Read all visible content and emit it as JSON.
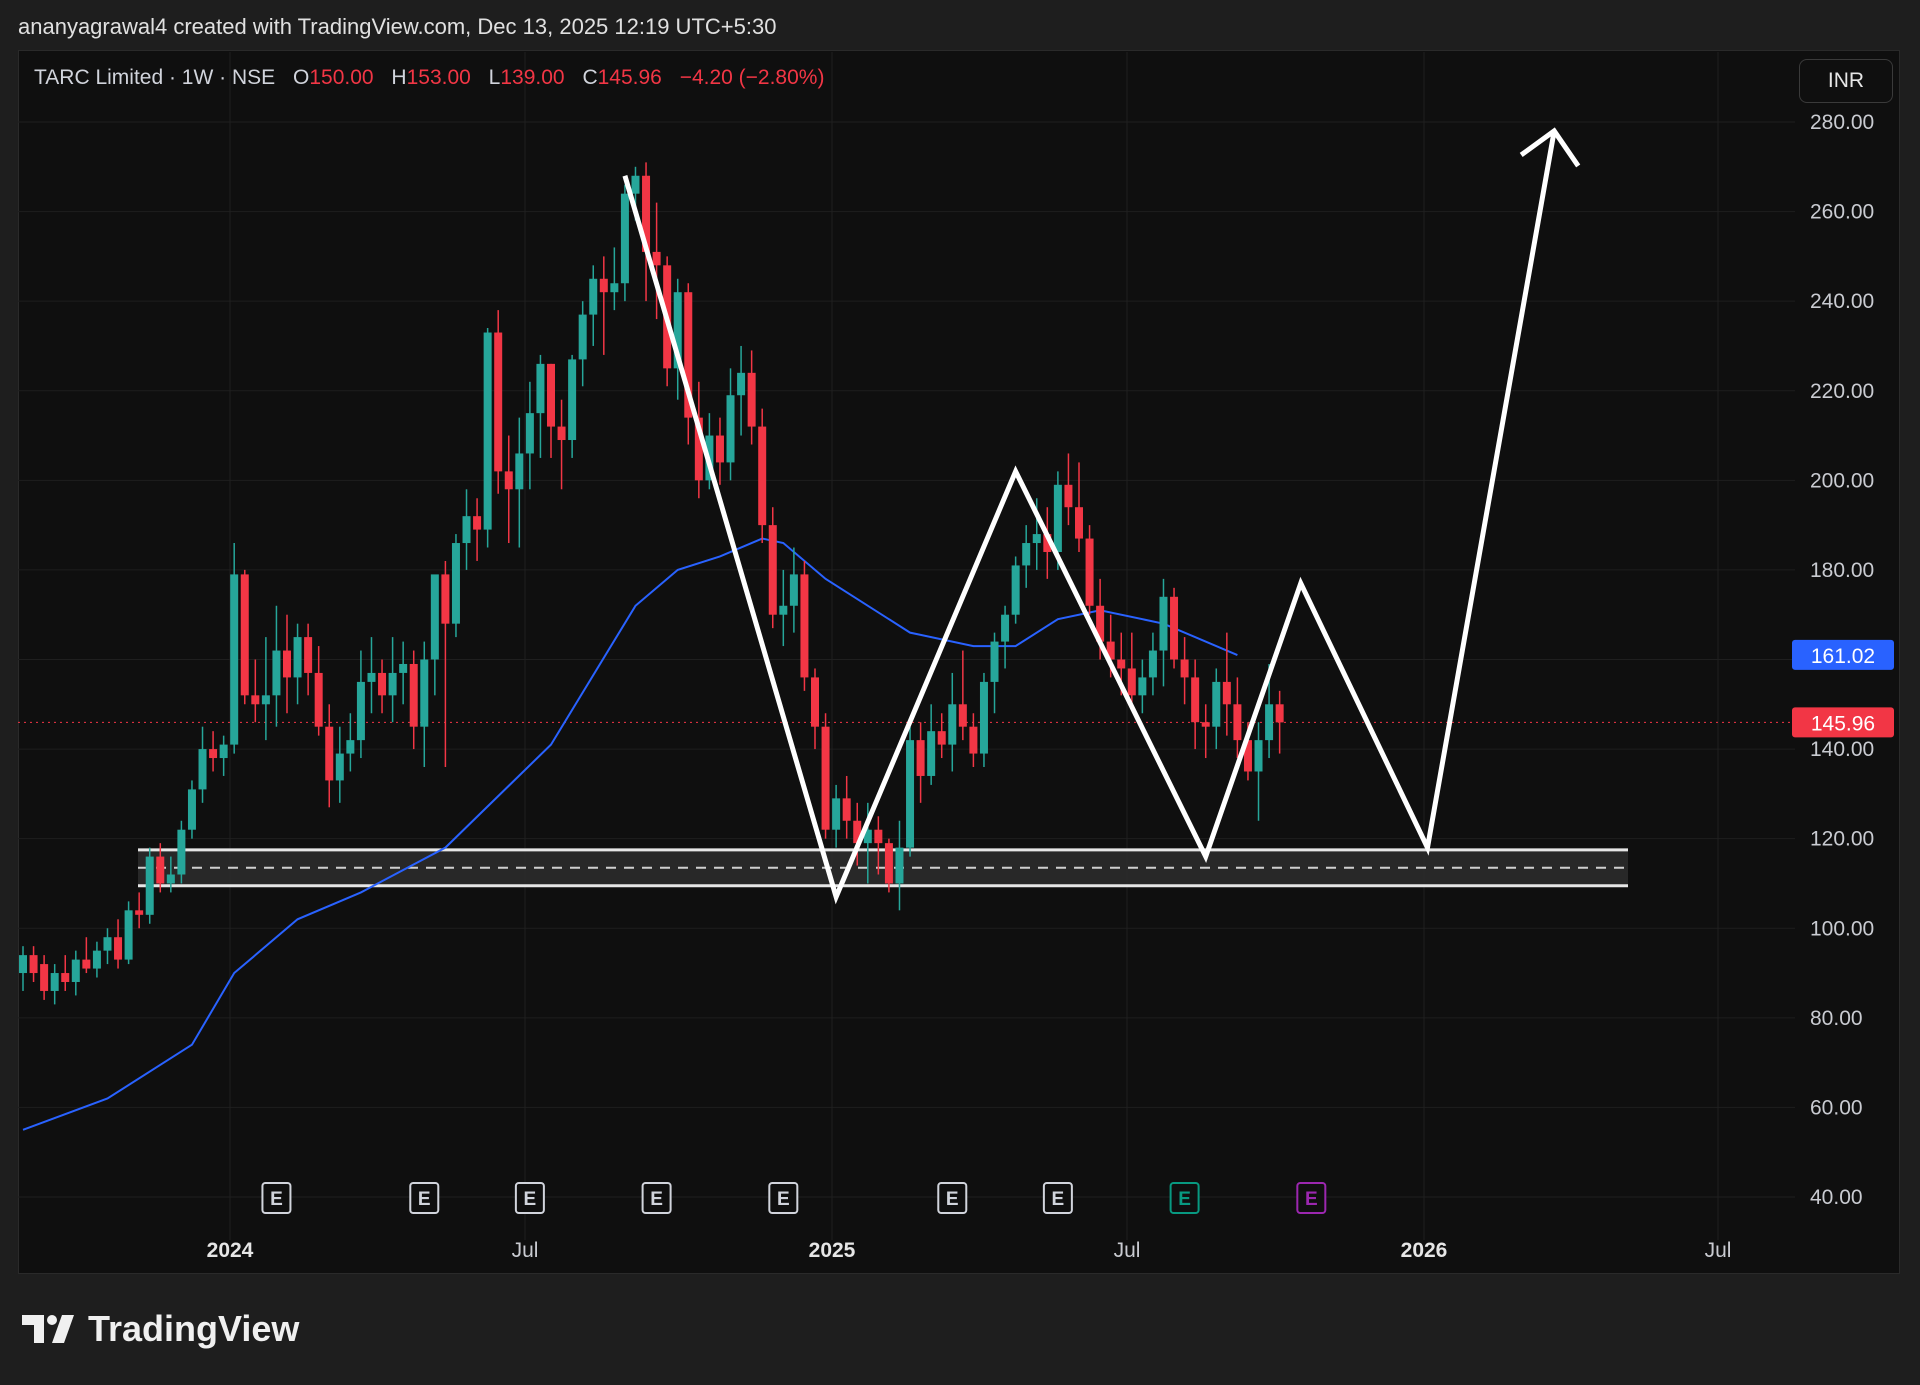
{
  "caption": "ananyagrawal4 created with TradingView.com, Dec 13, 2025 12:19 UTC+5:30",
  "legend": {
    "symbol": "TARC Limited · 1W · NSE",
    "o_label": "O",
    "o": "150.00",
    "h_label": "H",
    "h": "153.00",
    "l_label": "L",
    "l": "139.00",
    "c_label": "C",
    "c": "145.96",
    "change": "−4.20 (−2.80%)"
  },
  "currency_button": "INR",
  "brand": "TradingView",
  "colors": {
    "up": "#26a69a",
    "down": "#f23645",
    "ma": "#2962ff",
    "pattern": "#ffffff",
    "badge_ma": "#2962ff",
    "badge_price": "#f23645",
    "earnings_future": "#9c27b0",
    "earnings_next": "#089981"
  },
  "chart_data": {
    "type": "candlestick",
    "timeframe": "1W",
    "y_ticks": [
      "280.00",
      "260.00",
      "240.00",
      "220.00",
      "200.00",
      "180.00",
      "160.00",
      "140.00",
      "120.00",
      "100.00",
      "80.00",
      "60.00",
      "40.00"
    ],
    "ylim": [
      40,
      280
    ],
    "x_ticks": [
      "2024",
      "Jul",
      "2025",
      "Jul",
      "2026",
      "Jul"
    ],
    "last_price": 145.96,
    "last_price_label": "145.96",
    "ma_value": 161.02,
    "ma_label": "161.02",
    "ohlc": [
      {
        "o": 90,
        "h": 96,
        "l": 86,
        "c": 94
      },
      {
        "o": 94,
        "h": 96,
        "l": 88,
        "c": 90
      },
      {
        "o": 92,
        "h": 94,
        "l": 84,
        "c": 86
      },
      {
        "o": 86,
        "h": 92,
        "l": 83,
        "c": 90
      },
      {
        "o": 90,
        "h": 94,
        "l": 86,
        "c": 88
      },
      {
        "o": 88,
        "h": 95,
        "l": 85,
        "c": 93
      },
      {
        "o": 93,
        "h": 98,
        "l": 90,
        "c": 91
      },
      {
        "o": 91,
        "h": 97,
        "l": 89,
        "c": 95
      },
      {
        "o": 95,
        "h": 100,
        "l": 92,
        "c": 98
      },
      {
        "o": 98,
        "h": 102,
        "l": 91,
        "c": 93
      },
      {
        "o": 93,
        "h": 106,
        "l": 92,
        "c": 104
      },
      {
        "o": 104,
        "h": 108,
        "l": 100,
        "c": 103
      },
      {
        "o": 103,
        "h": 118,
        "l": 101,
        "c": 116
      },
      {
        "o": 116,
        "h": 119,
        "l": 108,
        "c": 110
      },
      {
        "o": 110,
        "h": 116,
        "l": 108,
        "c": 112
      },
      {
        "o": 112,
        "h": 124,
        "l": 110,
        "c": 122
      },
      {
        "o": 122,
        "h": 133,
        "l": 120,
        "c": 131
      },
      {
        "o": 131,
        "h": 145,
        "l": 128,
        "c": 140
      },
      {
        "o": 140,
        "h": 144,
        "l": 135,
        "c": 138
      },
      {
        "o": 138,
        "h": 143,
        "l": 134,
        "c": 141
      },
      {
        "o": 141,
        "h": 186,
        "l": 139,
        "c": 179
      },
      {
        "o": 179,
        "h": 180,
        "l": 150,
        "c": 152
      },
      {
        "o": 152,
        "h": 160,
        "l": 146,
        "c": 150
      },
      {
        "o": 150,
        "h": 165,
        "l": 142,
        "c": 152
      },
      {
        "o": 152,
        "h": 172,
        "l": 145,
        "c": 162
      },
      {
        "o": 162,
        "h": 170,
        "l": 148,
        "c": 156
      },
      {
        "o": 156,
        "h": 168,
        "l": 150,
        "c": 165
      },
      {
        "o": 165,
        "h": 168,
        "l": 152,
        "c": 157
      },
      {
        "o": 157,
        "h": 163,
        "l": 143,
        "c": 145
      },
      {
        "o": 145,
        "h": 150,
        "l": 127,
        "c": 133
      },
      {
        "o": 133,
        "h": 145,
        "l": 128,
        "c": 139
      },
      {
        "o": 139,
        "h": 148,
        "l": 135,
        "c": 142
      },
      {
        "o": 142,
        "h": 162,
        "l": 138,
        "c": 155
      },
      {
        "o": 155,
        "h": 165,
        "l": 148,
        "c": 157
      },
      {
        "o": 157,
        "h": 160,
        "l": 148,
        "c": 152
      },
      {
        "o": 152,
        "h": 165,
        "l": 146,
        "c": 157
      },
      {
        "o": 157,
        "h": 164,
        "l": 150,
        "c": 159
      },
      {
        "o": 159,
        "h": 162,
        "l": 140,
        "c": 145
      },
      {
        "o": 145,
        "h": 164,
        "l": 136,
        "c": 160
      },
      {
        "o": 160,
        "h": 174,
        "l": 152,
        "c": 179
      },
      {
        "o": 179,
        "h": 182,
        "l": 136,
        "c": 168
      },
      {
        "o": 168,
        "h": 188,
        "l": 165,
        "c": 186
      },
      {
        "o": 186,
        "h": 198,
        "l": 180,
        "c": 192
      },
      {
        "o": 192,
        "h": 196,
        "l": 182,
        "c": 189
      },
      {
        "o": 189,
        "h": 234,
        "l": 185,
        "c": 233
      },
      {
        "o": 233,
        "h": 238,
        "l": 197,
        "c": 202
      },
      {
        "o": 202,
        "h": 210,
        "l": 186,
        "c": 198
      },
      {
        "o": 198,
        "h": 214,
        "l": 185,
        "c": 206
      },
      {
        "o": 206,
        "h": 222,
        "l": 198,
        "c": 215
      },
      {
        "o": 215,
        "h": 228,
        "l": 205,
        "c": 226
      },
      {
        "o": 226,
        "h": 226,
        "l": 205,
        "c": 212
      },
      {
        "o": 212,
        "h": 218,
        "l": 198,
        "c": 209
      },
      {
        "o": 209,
        "h": 228,
        "l": 205,
        "c": 227
      },
      {
        "o": 227,
        "h": 240,
        "l": 221,
        "c": 237
      },
      {
        "o": 237,
        "h": 248,
        "l": 230,
        "c": 245
      },
      {
        "o": 245,
        "h": 250,
        "l": 228,
        "c": 242
      },
      {
        "o": 242,
        "h": 252,
        "l": 238,
        "c": 244
      },
      {
        "o": 244,
        "h": 266,
        "l": 240,
        "c": 264
      },
      {
        "o": 264,
        "h": 270,
        "l": 258,
        "c": 268
      },
      {
        "o": 268,
        "h": 271,
        "l": 240,
        "c": 251
      },
      {
        "o": 251,
        "h": 262,
        "l": 236,
        "c": 248
      },
      {
        "o": 248,
        "h": 250,
        "l": 221,
        "c": 225
      },
      {
        "o": 225,
        "h": 245,
        "l": 218,
        "c": 242
      },
      {
        "o": 242,
        "h": 244,
        "l": 208,
        "c": 214
      },
      {
        "o": 214,
        "h": 222,
        "l": 196,
        "c": 200
      },
      {
        "o": 200,
        "h": 215,
        "l": 198,
        "c": 210
      },
      {
        "o": 210,
        "h": 214,
        "l": 199,
        "c": 204
      },
      {
        "o": 204,
        "h": 225,
        "l": 200,
        "c": 219
      },
      {
        "o": 219,
        "h": 230,
        "l": 210,
        "c": 224
      },
      {
        "o": 224,
        "h": 229,
        "l": 208,
        "c": 212
      },
      {
        "o": 212,
        "h": 216,
        "l": 186,
        "c": 190
      },
      {
        "o": 190,
        "h": 194,
        "l": 167,
        "c": 170
      },
      {
        "o": 170,
        "h": 180,
        "l": 163,
        "c": 172
      },
      {
        "o": 172,
        "h": 185,
        "l": 166,
        "c": 179
      },
      {
        "o": 179,
        "h": 182,
        "l": 153,
        "c": 156
      },
      {
        "o": 156,
        "h": 158,
        "l": 140,
        "c": 145
      },
      {
        "o": 145,
        "h": 148,
        "l": 120,
        "c": 122
      },
      {
        "o": 122,
        "h": 132,
        "l": 118,
        "c": 129
      },
      {
        "o": 129,
        "h": 134,
        "l": 120,
        "c": 124
      },
      {
        "o": 124,
        "h": 128,
        "l": 114,
        "c": 119
      },
      {
        "o": 119,
        "h": 128,
        "l": 110,
        "c": 122
      },
      {
        "o": 122,
        "h": 125,
        "l": 112,
        "c": 119
      },
      {
        "o": 119,
        "h": 120,
        "l": 108,
        "c": 110
      },
      {
        "o": 110,
        "h": 124,
        "l": 104,
        "c": 118
      },
      {
        "o": 118,
        "h": 145,
        "l": 116,
        "c": 142
      },
      {
        "o": 142,
        "h": 146,
        "l": 128,
        "c": 134
      },
      {
        "o": 134,
        "h": 150,
        "l": 132,
        "c": 144
      },
      {
        "o": 144,
        "h": 148,
        "l": 138,
        "c": 141
      },
      {
        "o": 141,
        "h": 157,
        "l": 135,
        "c": 150
      },
      {
        "o": 150,
        "h": 162,
        "l": 142,
        "c": 145
      },
      {
        "o": 145,
        "h": 148,
        "l": 136,
        "c": 139
      },
      {
        "o": 139,
        "h": 157,
        "l": 136,
        "c": 155
      },
      {
        "o": 155,
        "h": 166,
        "l": 148,
        "c": 164
      },
      {
        "o": 164,
        "h": 172,
        "l": 158,
        "c": 170
      },
      {
        "o": 170,
        "h": 183,
        "l": 168,
        "c": 181
      },
      {
        "o": 181,
        "h": 190,
        "l": 176,
        "c": 186
      },
      {
        "o": 186,
        "h": 196,
        "l": 180,
        "c": 188
      },
      {
        "o": 188,
        "h": 194,
        "l": 178,
        "c": 184
      },
      {
        "o": 184,
        "h": 202,
        "l": 180,
        "c": 199
      },
      {
        "o": 199,
        "h": 206,
        "l": 190,
        "c": 194
      },
      {
        "o": 194,
        "h": 204,
        "l": 184,
        "c": 187
      },
      {
        "o": 187,
        "h": 190,
        "l": 170,
        "c": 172
      },
      {
        "o": 172,
        "h": 178,
        "l": 160,
        "c": 164
      },
      {
        "o": 164,
        "h": 170,
        "l": 156,
        "c": 160
      },
      {
        "o": 160,
        "h": 166,
        "l": 152,
        "c": 158
      },
      {
        "o": 158,
        "h": 166,
        "l": 150,
        "c": 152
      },
      {
        "o": 152,
        "h": 160,
        "l": 148,
        "c": 156
      },
      {
        "o": 156,
        "h": 166,
        "l": 152,
        "c": 162
      },
      {
        "o": 162,
        "h": 178,
        "l": 154,
        "c": 174
      },
      {
        "o": 174,
        "h": 176,
        "l": 158,
        "c": 160
      },
      {
        "o": 160,
        "h": 165,
        "l": 150,
        "c": 156
      },
      {
        "o": 156,
        "h": 160,
        "l": 140,
        "c": 146
      },
      {
        "o": 146,
        "h": 150,
        "l": 138,
        "c": 145
      },
      {
        "o": 145,
        "h": 158,
        "l": 140,
        "c": 155
      },
      {
        "o": 155,
        "h": 166,
        "l": 143,
        "c": 150
      },
      {
        "o": 150,
        "h": 156,
        "l": 138,
        "c": 142
      },
      {
        "o": 142,
        "h": 146,
        "l": 133,
        "c": 135
      },
      {
        "o": 135,
        "h": 146,
        "l": 124,
        "c": 142
      },
      {
        "o": 142,
        "h": 159,
        "l": 138,
        "c": 150
      },
      {
        "o": 150,
        "h": 153,
        "l": 139,
        "c": 145.96
      }
    ],
    "ma": [
      [
        0,
        55
      ],
      [
        8,
        62
      ],
      [
        16,
        74
      ],
      [
        20,
        90
      ],
      [
        26,
        102
      ],
      [
        32,
        108
      ],
      [
        40,
        118
      ],
      [
        50,
        141
      ],
      [
        58,
        172
      ],
      [
        62,
        180
      ],
      [
        66,
        183
      ],
      [
        70,
        187
      ],
      [
        72,
        186
      ],
      [
        76,
        178
      ],
      [
        84,
        166
      ],
      [
        90,
        163
      ],
      [
        94,
        163
      ],
      [
        98,
        169
      ],
      [
        102,
        171
      ],
      [
        108,
        168
      ],
      [
        115,
        161
      ]
    ],
    "support_zone": {
      "top": 117.5,
      "bottom": 109.5,
      "mid": 113.5
    },
    "pattern_path": [
      [
        57,
        268
      ],
      [
        77,
        107
      ],
      [
        94,
        202
      ],
      [
        112,
        116
      ],
      [
        121,
        177
      ],
      [
        133,
        118
      ],
      [
        145,
        278
      ]
    ],
    "earnings_markers": [
      24,
      38,
      48,
      60,
      72,
      88,
      98,
      110,
      122
    ]
  }
}
